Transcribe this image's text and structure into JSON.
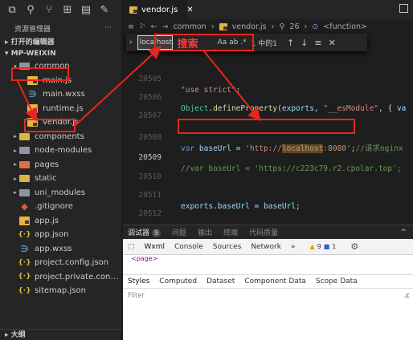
{
  "activity_bar": {
    "icons": [
      "files-icon",
      "search-icon",
      "source-control-icon",
      "extensions-icon",
      "remote-icon",
      "more-icon"
    ]
  },
  "explorer": {
    "title": "资源管理器",
    "more": "···"
  },
  "sections": {
    "open_editors": "打开的编辑器",
    "project": "MP-WEIXIN",
    "outline": "大纲"
  },
  "tree": [
    {
      "label": "common",
      "icon": "folder",
      "twist": "▾",
      "indent": 1
    },
    {
      "label": "main.js",
      "icon": "js",
      "twist": "",
      "indent": 2
    },
    {
      "label": "main.wxss",
      "icon": "wxss",
      "twist": "",
      "indent": 2
    },
    {
      "label": "runtime.js",
      "icon": "js",
      "twist": "",
      "indent": 2
    },
    {
      "label": "vendor.js",
      "icon": "js",
      "twist": "",
      "indent": 2
    },
    {
      "label": "components",
      "icon": "folder-yellow",
      "twist": "▸",
      "indent": 1
    },
    {
      "label": "node-modules",
      "icon": "folder",
      "twist": "▸",
      "indent": 1
    },
    {
      "label": "pages",
      "icon": "folder-orange",
      "twist": "▸",
      "indent": 1
    },
    {
      "label": "static",
      "icon": "folder-yellow",
      "twist": "▸",
      "indent": 1
    },
    {
      "label": "uni_modules",
      "icon": "folder",
      "twist": "▸",
      "indent": 1
    },
    {
      "label": ".gitignore",
      "icon": "git",
      "twist": "",
      "indent": 1
    },
    {
      "label": "app.js",
      "icon": "js",
      "twist": "",
      "indent": 1
    },
    {
      "label": "app.json",
      "icon": "json",
      "twist": "",
      "indent": 1
    },
    {
      "label": "app.wxss",
      "icon": "wxss",
      "twist": "",
      "indent": 1
    },
    {
      "label": "project.config.json",
      "icon": "json",
      "twist": "",
      "indent": 1
    },
    {
      "label": "project.private.config.js...",
      "icon": "json",
      "twist": "",
      "indent": 1
    },
    {
      "label": "sitemap.json",
      "icon": "json",
      "twist": "",
      "indent": 1
    }
  ],
  "tab": {
    "label": "vendor.js",
    "close": "✕"
  },
  "breadcrumb": {
    "parts": [
      "common",
      "vendor.js",
      "26",
      "<function>"
    ]
  },
  "find": {
    "value": "localhost",
    "annotation": "搜索",
    "options": "Aa  ab  .*",
    "count": "1 中的1"
  },
  "code": {
    "lines": [
      {
        "n": "20505",
        "text": "\"use strict\";"
      },
      {
        "n": "20506",
        "text": "Object.defineProperty(exports, \"__esModule\", { va"
      },
      {
        "n": "20507",
        "text": ""
      },
      {
        "n": "20508",
        "text": "var baseUrl = 'http://localhost:8080';//请求nginx"
      },
      {
        "n": "20509",
        "text": "//var baseUrl = 'https://c223c79.r2.cpolar.top';"
      },
      {
        "n": "20510",
        "text": ""
      },
      {
        "n": "20511",
        "text": "exports.baseUrl = baseUrl;"
      },
      {
        "n": "20512",
        "text": ""
      }
    ]
  },
  "devtools": {
    "top_tabs": [
      "调试器",
      "问题",
      "输出",
      "终端",
      "代码质量"
    ],
    "badge": "9",
    "toolbar": [
      "Wxml",
      "Console",
      "Sources",
      "Network",
      "»"
    ],
    "warnings": "9",
    "infos": "1",
    "node": "<page>",
    "style_tabs": [
      "Styles",
      "Computed",
      "Dataset",
      "Component Data",
      "Scope Data"
    ],
    "filter": "Filter",
    "filter_right": ".c"
  },
  "colors": {
    "annotation": "#e8251e",
    "string": "#ce9178",
    "keyword": "#569cd6",
    "comment": "#6a9955"
  }
}
